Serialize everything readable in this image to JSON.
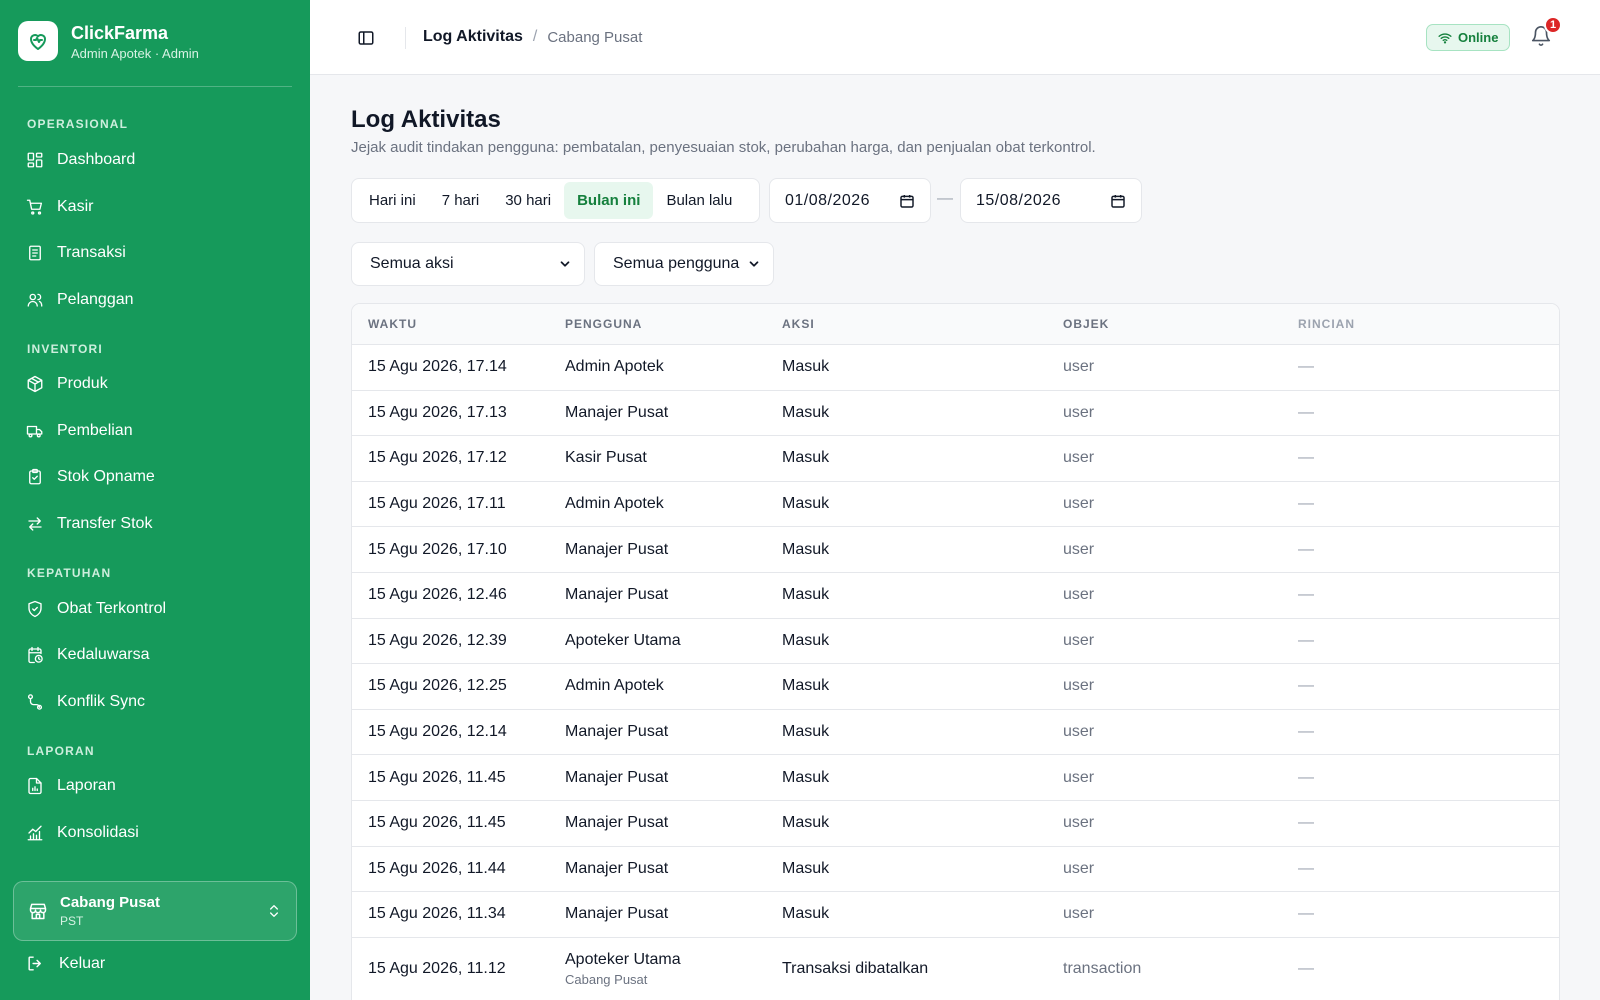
{
  "app": {
    "name": "ClickFarma",
    "user_line": "Admin Apotek · Admin"
  },
  "sidebar": {
    "sections": [
      {
        "title": "OPERASIONAL",
        "items": [
          {
            "label": "Dashboard",
            "icon": "dashboard-icon"
          },
          {
            "label": "Kasir",
            "icon": "cart-icon"
          },
          {
            "label": "Transaksi",
            "icon": "receipt-icon"
          },
          {
            "label": "Pelanggan",
            "icon": "users-icon"
          }
        ]
      },
      {
        "title": "INVENTORI",
        "items": [
          {
            "label": "Produk",
            "icon": "package-icon"
          },
          {
            "label": "Pembelian",
            "icon": "truck-icon"
          },
          {
            "label": "Stok Opname",
            "icon": "clipboard-check-icon"
          },
          {
            "label": "Transfer Stok",
            "icon": "arrows-exchange-icon"
          }
        ]
      },
      {
        "title": "KEPATUHAN",
        "items": [
          {
            "label": "Obat Terkontrol",
            "icon": "shield-check-icon"
          },
          {
            "label": "Kedaluwarsa",
            "icon": "calendar-clock-icon"
          },
          {
            "label": "Konflik Sync",
            "icon": "route-icon"
          }
        ]
      },
      {
        "title": "LAPORAN",
        "items": [
          {
            "label": "Laporan",
            "icon": "report-file-icon"
          },
          {
            "label": "Konsolidasi",
            "icon": "bar-chart-icon"
          }
        ]
      }
    ],
    "branch": {
      "name": "Cabang Pusat",
      "code": "PST"
    },
    "logout_label": "Keluar"
  },
  "topbar": {
    "breadcrumb_main": "Log Aktivitas",
    "breadcrumb_separator": "/",
    "breadcrumb_sub": "Cabang Pusat",
    "status_label": "Online",
    "notification_count": "1"
  },
  "page": {
    "title": "Log Aktivitas",
    "description": "Jejak audit tindakan pengguna: pembatalan, penyesuaian stok, perubahan harga, dan penjualan obat terkontrol."
  },
  "filters": {
    "ranges": [
      "Hari ini",
      "7 hari",
      "30 hari",
      "Bulan ini",
      "Bulan lalu"
    ],
    "active_range": "Bulan ini",
    "date_from": "01/08/2026",
    "date_separator": "—",
    "date_to": "15/08/2026",
    "action_select": "Semua aksi",
    "user_select": "Semua pengguna"
  },
  "table": {
    "columns": [
      "WAKTU",
      "PENGGUNA",
      "AKSI",
      "OBJEK",
      "RINCIAN"
    ],
    "rows": [
      {
        "waktu": "15 Agu 2026, 17.14",
        "pengguna": "Admin Apotek",
        "aksi": "Masuk",
        "objek": "user",
        "rincian": "—"
      },
      {
        "waktu": "15 Agu 2026, 17.13",
        "pengguna": "Manajer Pusat",
        "aksi": "Masuk",
        "objek": "user",
        "rincian": "—"
      },
      {
        "waktu": "15 Agu 2026, 17.12",
        "pengguna": "Kasir Pusat",
        "aksi": "Masuk",
        "objek": "user",
        "rincian": "—"
      },
      {
        "waktu": "15 Agu 2026, 17.11",
        "pengguna": "Admin Apotek",
        "aksi": "Masuk",
        "objek": "user",
        "rincian": "—"
      },
      {
        "waktu": "15 Agu 2026, 17.10",
        "pengguna": "Manajer Pusat",
        "aksi": "Masuk",
        "objek": "user",
        "rincian": "—"
      },
      {
        "waktu": "15 Agu 2026, 12.46",
        "pengguna": "Manajer Pusat",
        "aksi": "Masuk",
        "objek": "user",
        "rincian": "—"
      },
      {
        "waktu": "15 Agu 2026, 12.39",
        "pengguna": "Apoteker Utama",
        "aksi": "Masuk",
        "objek": "user",
        "rincian": "—"
      },
      {
        "waktu": "15 Agu 2026, 12.25",
        "pengguna": "Admin Apotek",
        "aksi": "Masuk",
        "objek": "user",
        "rincian": "—"
      },
      {
        "waktu": "15 Agu 2026, 12.14",
        "pengguna": "Manajer Pusat",
        "aksi": "Masuk",
        "objek": "user",
        "rincian": "—"
      },
      {
        "waktu": "15 Agu 2026, 11.45",
        "pengguna": "Manajer Pusat",
        "aksi": "Masuk",
        "objek": "user",
        "rincian": "—"
      },
      {
        "waktu": "15 Agu 2026, 11.45",
        "pengguna": "Manajer Pusat",
        "aksi": "Masuk",
        "objek": "user",
        "rincian": "—"
      },
      {
        "waktu": "15 Agu 2026, 11.44",
        "pengguna": "Manajer Pusat",
        "aksi": "Masuk",
        "objek": "user",
        "rincian": "—"
      },
      {
        "waktu": "15 Agu 2026, 11.34",
        "pengguna": "Manajer Pusat",
        "aksi": "Masuk",
        "objek": "user",
        "rincian": "—"
      },
      {
        "waktu": "15 Agu 2026, 11.12",
        "pengguna": "Apoteker Utama",
        "pengguna_cabang": "Cabang Pusat",
        "aksi": "Transaksi dibatalkan",
        "objek": "transaction",
        "rincian": "—"
      }
    ]
  },
  "colors": {
    "sidebar_bg": "#169a5b",
    "accent": "#15803d",
    "accent_soft": "#e7f7ee",
    "badge_red": "#dc2626"
  }
}
